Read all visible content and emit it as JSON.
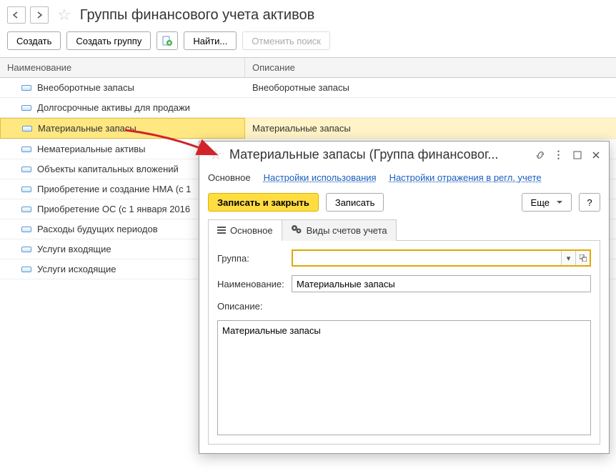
{
  "header": {
    "title": "Группы финансового учета активов"
  },
  "toolbar": {
    "create": "Создать",
    "create_group": "Создать группу",
    "find": "Найти...",
    "cancel_search": "Отменить поиск"
  },
  "grid": {
    "col_name": "Наименование",
    "col_desc": "Описание",
    "rows": [
      {
        "name": "Внеоборотные запасы",
        "desc": "Внеоборотные запасы"
      },
      {
        "name": "Долгосрочные активы для продажи",
        "desc": ""
      },
      {
        "name": "Материальные запасы",
        "desc": "Материальные запасы",
        "selected": true
      },
      {
        "name": "Нематериальные активы",
        "desc": ""
      },
      {
        "name": "Объекты капитальных вложений",
        "desc": ""
      },
      {
        "name": "Приобретение и создание НМА (с 1",
        "desc": ""
      },
      {
        "name": "Приобретение ОС (с 1 января 2016",
        "desc": ""
      },
      {
        "name": "Расходы будущих периодов",
        "desc": ""
      },
      {
        "name": "Услуги входящие",
        "desc": ""
      },
      {
        "name": "Услуги исходящие",
        "desc": ""
      }
    ]
  },
  "dialog": {
    "title": "Материальные запасы (Группа финансовог...",
    "nav": {
      "main": "Основное",
      "usage": "Настройки использования",
      "regl": "Настройки отражения в регл. учете"
    },
    "buttons": {
      "save_close": "Записать и закрыть",
      "save": "Записать",
      "more": "Еще",
      "help": "?"
    },
    "tabs": {
      "main": "Основное",
      "accounts": "Виды счетов учета"
    },
    "form": {
      "group_label": "Группа:",
      "group_value": "",
      "name_label": "Наименование:",
      "name_value": "Материальные запасы",
      "desc_label": "Описание:",
      "desc_value": "Материальные запасы"
    }
  }
}
